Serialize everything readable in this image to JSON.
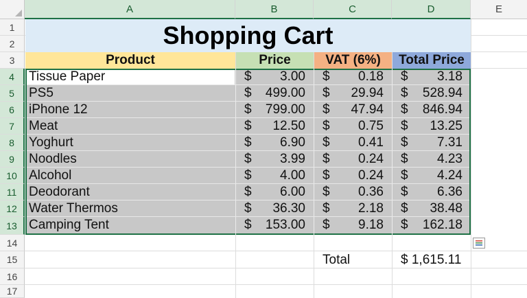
{
  "column_headers": [
    "A",
    "B",
    "C",
    "D",
    "E"
  ],
  "row_numbers": [
    "1",
    "2",
    "3",
    "4",
    "5",
    "6",
    "7",
    "8",
    "9",
    "10",
    "11",
    "12",
    "13",
    "14",
    "15",
    "16",
    "17"
  ],
  "title": "Shopping Cart",
  "headers": {
    "product": "Product",
    "price": "Price",
    "vat": "VAT (6%)",
    "total": "Total Price"
  },
  "currency_symbol": "$",
  "items": [
    {
      "product": "Tissue Paper",
      "price": "3.00",
      "vat": "0.18",
      "total": "3.18"
    },
    {
      "product": "PS5",
      "price": "499.00",
      "vat": "29.94",
      "total": "528.94"
    },
    {
      "product": "iPhone 12",
      "price": "799.00",
      "vat": "47.94",
      "total": "846.94"
    },
    {
      "product": "Meat",
      "price": "12.50",
      "vat": "0.75",
      "total": "13.25"
    },
    {
      "product": "Yoghurt",
      "price": "6.90",
      "vat": "0.41",
      "total": "7.31"
    },
    {
      "product": "Noodles",
      "price": "3.99",
      "vat": "0.24",
      "total": "4.23"
    },
    {
      "product": "Alcohol",
      "price": "4.00",
      "vat": "0.24",
      "total": "4.24"
    },
    {
      "product": "Deodorant",
      "price": "6.00",
      "vat": "0.36",
      "total": "6.36"
    },
    {
      "product": "Water Thermos",
      "price": "36.30",
      "vat": "2.18",
      "total": "38.48"
    },
    {
      "product": "Camping Tent",
      "price": "153.00",
      "vat": "9.18",
      "total": "162.18"
    }
  ],
  "summary": {
    "label": "Total",
    "value": "$ 1,615.11"
  },
  "colors": {
    "title_fill": "#ddebf7",
    "product_header": "#ffe699",
    "price_header": "#c6e0b4",
    "vat_header": "#f4b183",
    "total_header": "#8ea9db",
    "selection_fill": "#c8c8c8",
    "selection_border": "#1e7145"
  },
  "quick_analysis_icon": "quick-analysis-icon"
}
